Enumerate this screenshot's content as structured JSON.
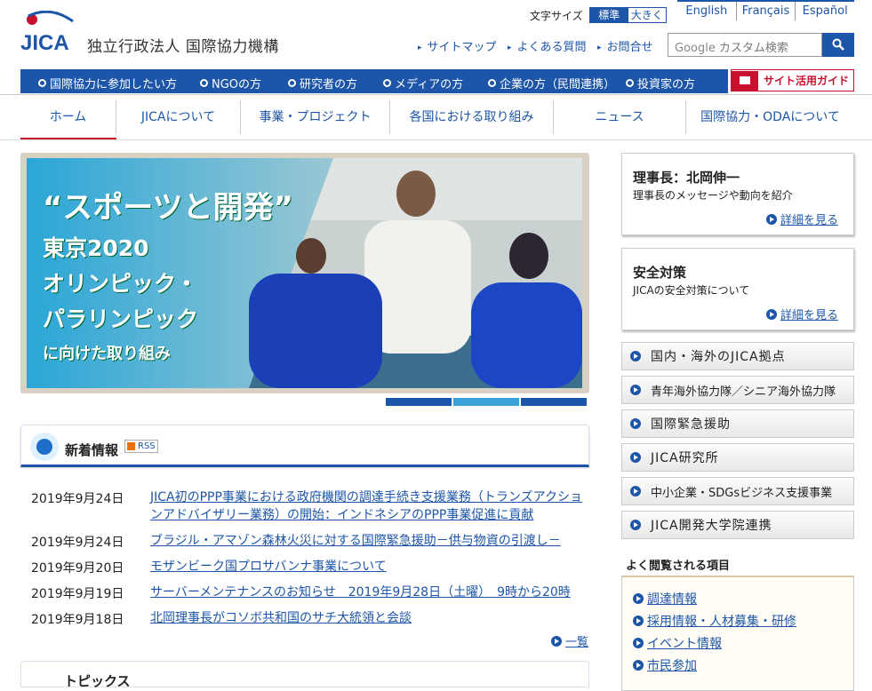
{
  "header": {
    "org_name": "独立行政法人 国際協力機構",
    "logo_text": "JICA",
    "fontsize_label": "文字サイズ",
    "fontsize_standard": "標準",
    "fontsize_large": "大きく",
    "languages": [
      "English",
      "Français",
      "Español"
    ],
    "util_links": [
      "サイトマップ",
      "よくある質問",
      "お問合せ"
    ],
    "search_brand": "Google",
    "search_placeholder": "カスタム検索"
  },
  "user_nav": [
    "国際協力に参加したい方",
    "NGOの方",
    "研究者の方",
    "メディアの方",
    "企業の方（民間連携）",
    "投資家の方"
  ],
  "guide_label": "サイト活用ガイド",
  "main_nav": [
    "ホーム",
    "JICAについて",
    "事業・プロジェクト",
    "各国における取り組み",
    "ニュース",
    "国際協力・ODAについて"
  ],
  "hero": {
    "lines": [
      "“スポーツと開発”",
      "東京2020",
      "オリンピック・",
      "パラリンピック",
      "に向けた取り組み"
    ]
  },
  "news": {
    "title": "新着情報",
    "rss": "RSS",
    "items": [
      {
        "date": "2019年9月24日",
        "text": "JICA初のPPP事業における政府機関の調達手続き支援業務（トランズアクションアドバイザリー業務）の開始：インドネシアのPPP事業促進に貢献"
      },
      {
        "date": "2019年9月24日",
        "text": "ブラジル・アマゾン森林火災に対する国際緊急援助－供与物資の引渡し－"
      },
      {
        "date": "2019年9月20日",
        "text": "モザンビーク国プロサバンナ事業について"
      },
      {
        "date": "2019年9月19日",
        "text": "サーバーメンテナンスのお知らせ　2019年9月28日（土曜）　9時から20時"
      },
      {
        "date": "2019年9月18日",
        "text": "北岡理事長がコソボ共和国のサチ大統領と会談"
      }
    ],
    "more": "一覧"
  },
  "topics": {
    "title": "トピックス"
  },
  "cards": [
    {
      "title": "理事長：北岡伸一",
      "desc": "理事長のメッセージや動向を紹介",
      "more": "詳細を見る"
    },
    {
      "title": "安全対策",
      "desc": "JICAの安全対策について",
      "more": "詳細を見る"
    }
  ],
  "side_buttons": [
    "国内・海外のJICA拠点",
    "青年海外協力隊／シニア海外協力隊",
    "国際緊急援助",
    "JICA研究所",
    "中小企業・SDGsビジネス支援事業",
    "JICA開発大学院連携"
  ],
  "popular": {
    "title": "よく閲覧される項目",
    "items": [
      "調達情報",
      "採用情報・人材募集・研修",
      "イベント情報",
      "市民参加"
    ]
  },
  "colors": {
    "brand_blue": "#1d56a8",
    "accent_red": "#c8102e"
  }
}
